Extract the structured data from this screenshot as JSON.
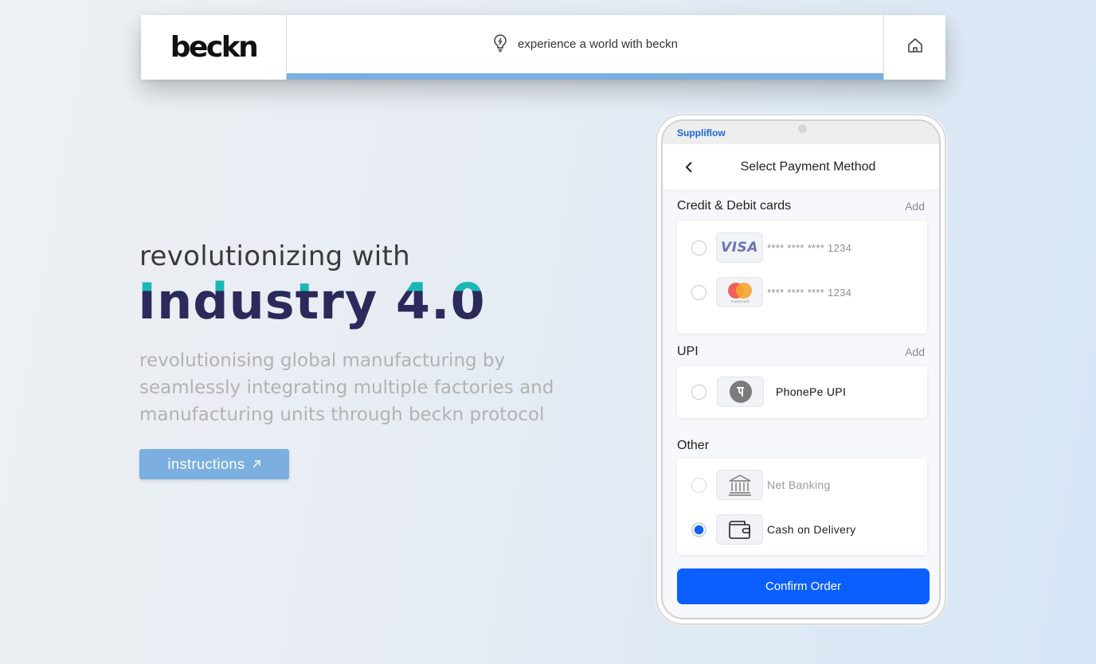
{
  "topbar": {
    "logo_text": "beckn",
    "tagline": "experience a world with beckn"
  },
  "hero": {
    "subtitle": "revolutionizing with",
    "title": "Industry 4.0",
    "description": "revolutionising global manufacturing by seamlessly integrating multiple factories and manufacturing units through beckn protocol",
    "button_label": "instructions"
  },
  "phone": {
    "brand": "Suppliflow",
    "header_title": "Select Payment Method",
    "sections": {
      "cards": {
        "title": "Credit & Debit cards",
        "add": "Add",
        "items": [
          {
            "logo": "VISA",
            "number": "**** **** **** 1234"
          },
          {
            "logo": "mastercard",
            "number": "**** **** **** 1234"
          }
        ]
      },
      "upi": {
        "title": "UPI",
        "add": "Add",
        "items": [
          {
            "label": "PhonePe UPI"
          }
        ]
      },
      "other": {
        "title": "Other",
        "items": [
          {
            "label": "Net Banking",
            "selected": false
          },
          {
            "label": "Cash on Delivery",
            "selected": true
          }
        ]
      }
    },
    "confirm_label": "Confirm Order"
  },
  "colors": {
    "accent": "#0b5fff",
    "topbar_bar": "#7aafe0",
    "title_teal": "#19b8b5",
    "title_navy": "#2c2a5a",
    "brand_blue": "#1b66d6"
  },
  "icons": [
    "lightbulb-icon",
    "home-icon",
    "arrow-up-right-icon",
    "chevron-left-icon",
    "phonepe-icon",
    "bank-icon",
    "wallet-icon"
  ]
}
